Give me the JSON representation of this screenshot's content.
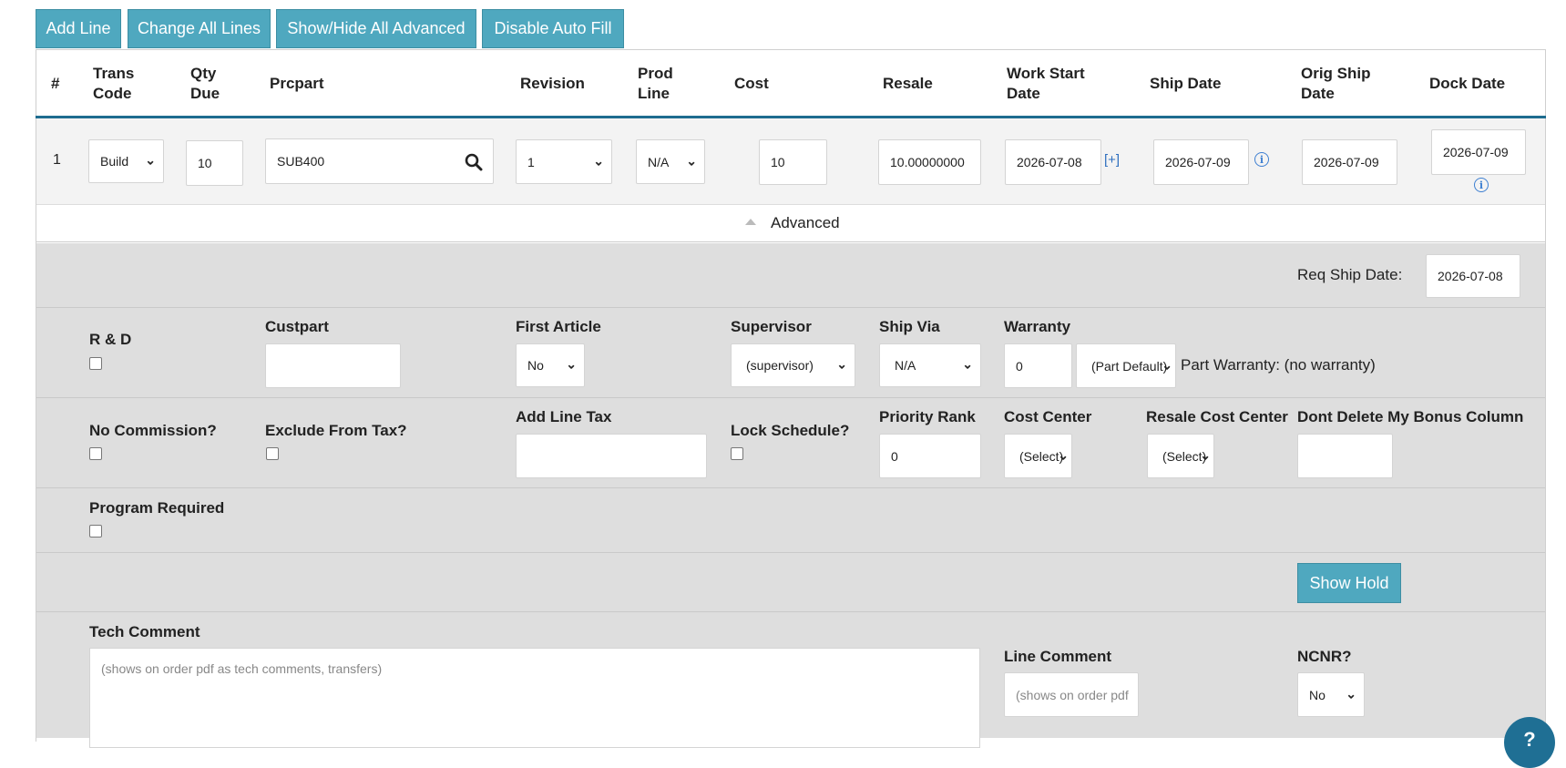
{
  "toolbar": {
    "add_line": "Add Line",
    "change_all_lines": "Change All Lines",
    "show_hide_advanced": "Show/Hide All Advanced",
    "disable_auto_fill": "Disable Auto Fill"
  },
  "table": {
    "headers": {
      "num": "#",
      "trans_code": "Trans\nCode",
      "qty_due": "Qty\nDue",
      "prcpart": "Prcpart",
      "revision": "Revision",
      "prod_line": "Prod\nLine",
      "cost": "Cost",
      "resale": "Resale",
      "work_start_date": "Work Start\nDate",
      "ship_date": "Ship Date",
      "orig_ship_date": "Orig Ship\nDate",
      "dock_date": "Dock Date"
    },
    "row": {
      "num": "1",
      "trans_code": "Build",
      "qty_due": "10",
      "prcpart": "SUB400",
      "revision": "1",
      "prod_line": "N/A",
      "cost": "10",
      "resale": "10.00000000",
      "work_start_date": "2026-07-08",
      "plus_link": "[+]",
      "ship_date": "2026-07-09",
      "orig_ship_date": "2026-07-09",
      "dock_date": "2026-07-09"
    }
  },
  "advanced": {
    "toggle_label": "Advanced",
    "req_ship_date_label": "Req Ship Date:",
    "req_ship_date": "2026-07-08",
    "rd_label": "R & D",
    "custpart_label": "Custpart",
    "custpart_value": "",
    "first_article_label": "First Article",
    "first_article_value": "No",
    "supervisor_label": "Supervisor",
    "supervisor_value": "(supervisor)",
    "ship_via_label": "Ship Via",
    "ship_via_value": "N/A",
    "warranty_label": "Warranty",
    "warranty_value": "0",
    "warranty_type": "(Part Default)",
    "part_warranty_text": "Part Warranty: (no warranty)",
    "no_commission_label": "No Commission?",
    "exclude_tax_label": "Exclude From Tax?",
    "add_line_tax_label": "Add Line Tax",
    "add_line_tax_value": "",
    "lock_schedule_label": "Lock Schedule?",
    "priority_rank_label": "Priority Rank",
    "priority_rank_value": "0",
    "cost_center_label": "Cost Center",
    "cost_center_value": "(Select)",
    "resale_cost_center_label": "Resale Cost Center",
    "resale_cost_center_value": "(Select)",
    "dont_delete_label": "Dont Delete My Bonus Column",
    "dont_delete_value": "",
    "program_required_label": "Program Required",
    "show_hold": "Show Hold",
    "tech_comment_label": "Tech Comment",
    "tech_comment_placeholder": "(shows on order pdf as tech comments, transfers)",
    "line_comment_label": "Line Comment",
    "line_comment_placeholder": "(shows on order pdf",
    "ncnr_label": "NCNR?",
    "ncnr_value": "No"
  },
  "help": {
    "icon": "?"
  }
}
